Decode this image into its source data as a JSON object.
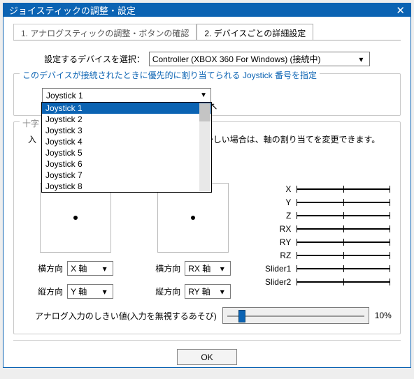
{
  "title": "ジョイスティックの調整・設定",
  "tabs": {
    "t1": "1. アナログスティックの調整・ボタンの確認",
    "t2": "2. デバイスごとの詳細設定"
  },
  "devlabel": "設定するデバイスを選択：",
  "devvalue": "Controller (XBOX 360 For Windows) (接続中)",
  "grp1": {
    "legend": "このデバイスが接続されたときに優先的に割り当てられる Joystick 番号を指定",
    "current": "Joystick 1",
    "options": [
      "Joystick 1",
      "Joystick 2",
      "Joystick 3",
      "Joystick 4",
      "Joystick 5",
      "Joystick 6",
      "Joystick 7",
      "Joystick 8"
    ]
  },
  "grp2": {
    "legend_trunc": "十字",
    "note_prefix": "入",
    "note_suffix": "がおかしい場合は、軸の割り当てを変更できます。",
    "pads": [
      {
        "hlabel": "横方向",
        "hvalue": "X 軸",
        "vlabel": "縦方向",
        "vvalue": "Y 軸"
      },
      {
        "hlabel": "横方向",
        "hvalue": "RX 軸",
        "vlabel": "縦方向",
        "vvalue": "RY 軸"
      }
    ],
    "bars": [
      "X",
      "Y",
      "Z",
      "RX",
      "RY",
      "RZ",
      "Slider1",
      "Slider2"
    ]
  },
  "thresh": {
    "label": "アナログ入力のしきい値(入力を無視するあそび)",
    "value": "10%"
  },
  "ok": "OK"
}
